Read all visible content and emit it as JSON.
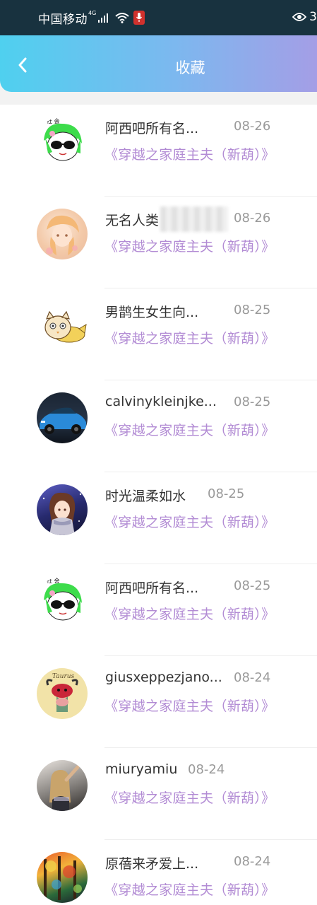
{
  "status_bar": {
    "carrier": "中国移动",
    "network": "4G",
    "eye_count": "3"
  },
  "header": {
    "title": "收藏"
  },
  "items": [
    {
      "name": "阿西吧所有名...",
      "date": "08-26",
      "book": "《穿越之家庭主夫（新葫）》",
      "avatar": "green-hair-sunglasses"
    },
    {
      "name": "无名人类",
      "date": "08-26",
      "book": "《穿越之家庭主夫（新葫）》",
      "avatar": "anime-girl"
    },
    {
      "name": "男鹊生女生向...",
      "date": "08-25",
      "book": "《穿越之家庭主夫（新葫）》",
      "avatar": "cartoon-owl-cat"
    },
    {
      "name": "calvinykleinjke...",
      "date": "08-25",
      "book": "《穿越之家庭主夫（新葫）》",
      "avatar": "blue-sports-car"
    },
    {
      "name": "时光温柔如水",
      "date": "08-25",
      "book": "《穿越之家庭主夫（新葫）》",
      "avatar": "anime-girl-scarf"
    },
    {
      "name": "阿西吧所有名...",
      "date": "08-25",
      "book": "《穿越之家庭主夫（新葫）》",
      "avatar": "green-hair-sunglasses"
    },
    {
      "name": "giusxeppezjano...",
      "date": "08-24",
      "book": "《穿越之家庭主夫（新葫）》",
      "avatar": "taurus-cartoon"
    },
    {
      "name": "miuryamiu",
      "date": "08-24",
      "book": "《穿越之家庭主夫（新葫）》",
      "avatar": "girl-photo"
    },
    {
      "name": "原蓓来矛爱上...",
      "date": "08-24",
      "book": "《穿越之家庭主夫（新葫）》",
      "avatar": "colorful-painting"
    }
  ]
}
